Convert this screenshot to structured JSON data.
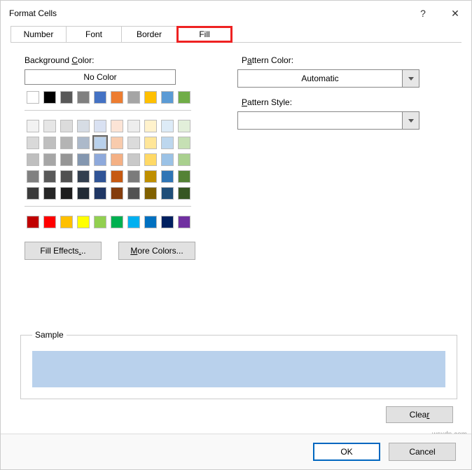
{
  "title": "Format Cells",
  "tabs": [
    "Number",
    "Font",
    "Border",
    "Fill"
  ],
  "active_tab": "Fill",
  "left": {
    "background_color_label": "Background Color:",
    "no_color": "No Color",
    "fill_effects": "Fill Effects...",
    "more_colors": "More Colors...",
    "selected_color": "#b9d1ec",
    "theme_row": [
      "#ffffff",
      "#000000",
      "#595959",
      "#808080",
      "#4472c4",
      "#ed7d31",
      "#a5a5a5",
      "#ffc000",
      "#5b9bd5",
      "#70ad47"
    ],
    "tints": [
      [
        "#f2f2f2",
        "#e6e6e6",
        "#dcdcdc",
        "#d6dce4",
        "#d9e1f2",
        "#fce4d6",
        "#ededed",
        "#fff2cc",
        "#ddebf7",
        "#e2efda"
      ],
      [
        "#d9d9d9",
        "#bfbfbf",
        "#b4b4b4",
        "#acb9ca",
        "#b9d1ec",
        "#f8cbad",
        "#dbdbdb",
        "#ffe699",
        "#bdd7ee",
        "#c6e0b4"
      ],
      [
        "#bfbfbf",
        "#a6a6a6",
        "#969696",
        "#8497b0",
        "#8ea9db",
        "#f4b084",
        "#c9c9c9",
        "#ffd966",
        "#9bc2e6",
        "#a9d08e"
      ],
      [
        "#808080",
        "#595959",
        "#505050",
        "#333f4f",
        "#305496",
        "#c65911",
        "#7b7b7b",
        "#bf8f00",
        "#2f75b5",
        "#548235"
      ],
      [
        "#3a3a3a",
        "#262626",
        "#1c1c1c",
        "#222b35",
        "#203764",
        "#833c0c",
        "#525252",
        "#806000",
        "#1f4e78",
        "#375623"
      ]
    ],
    "standard": [
      "#c00000",
      "#ff0000",
      "#ffc000",
      "#ffff00",
      "#92d050",
      "#00b050",
      "#00b0f0",
      "#0070c0",
      "#002060",
      "#7030a0"
    ]
  },
  "right": {
    "pattern_color_label": "Pattern Color:",
    "pattern_color_value": "Automatic",
    "pattern_style_label": "Pattern Style:",
    "pattern_style_value": ""
  },
  "sample": {
    "label": "Sample",
    "color": "#b9d1ec"
  },
  "buttons": {
    "help": "?",
    "close": "✕",
    "clear": "Clear",
    "ok": "OK",
    "cancel": "Cancel"
  },
  "watermark": "wsxdn.com"
}
